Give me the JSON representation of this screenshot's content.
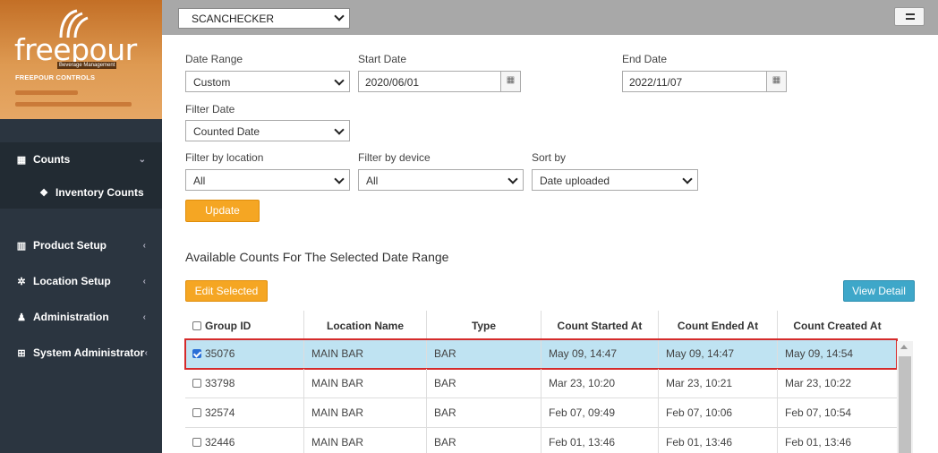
{
  "brand": {
    "name": "freepour",
    "tagline": "Beverage Management",
    "sub": "FREEPOUR CONTROLS"
  },
  "sidebar": {
    "items": [
      {
        "label": "Counts",
        "icon": "table-icon"
      },
      {
        "label": "Inventory Counts",
        "icon": "cubes-icon"
      },
      {
        "label": "Product Setup",
        "icon": "bar-chart-icon"
      },
      {
        "label": "Location Setup",
        "icon": "gear-icon"
      },
      {
        "label": "Administration",
        "icon": "user-icon"
      },
      {
        "label": "System Administrator",
        "icon": "windows-icon"
      }
    ]
  },
  "topbar": {
    "venue": "SCANCHECKER"
  },
  "filters": {
    "date_range_label": "Date Range",
    "date_range_value": "Custom",
    "start_date_label": "Start Date",
    "start_date_value": "2020/06/01",
    "end_date_label": "End Date",
    "end_date_value": "2022/11/07",
    "filter_date_label": "Filter Date",
    "filter_date_value": "Counted Date",
    "location_label": "Filter by location",
    "location_value": "All",
    "device_label": "Filter by device",
    "device_value": "All",
    "sort_label": "Sort by",
    "sort_value": "Date uploaded",
    "update_label": "Update"
  },
  "section_title": "Available Counts For The Selected Date Range",
  "actions": {
    "edit_label": "Edit Selected",
    "view_label": "View Detail"
  },
  "table": {
    "headers": [
      "Group ID",
      "Location Name",
      "Type",
      "Count Started At",
      "Count Ended At",
      "Count Created At"
    ],
    "rows": [
      {
        "id": "35076",
        "location": "MAIN BAR",
        "type": "BAR",
        "started": "May 09, 14:47",
        "ended": "May 09, 14:47",
        "created": "May 09, 14:54",
        "checked": true
      },
      {
        "id": "33798",
        "location": "MAIN BAR",
        "type": "BAR",
        "started": "Mar 23, 10:20",
        "ended": "Mar 23, 10:21",
        "created": "Mar 23, 10:22",
        "checked": false
      },
      {
        "id": "32574",
        "location": "MAIN BAR",
        "type": "BAR",
        "started": "Feb 07, 09:49",
        "ended": "Feb 07, 10:06",
        "created": "Feb 07, 10:54",
        "checked": false
      },
      {
        "id": "32446",
        "location": "MAIN BAR",
        "type": "BAR",
        "started": "Feb 01, 13:46",
        "ended": "Feb 01, 13:46",
        "created": "Feb 01, 13:46",
        "checked": false
      }
    ]
  },
  "colors": {
    "sidebar": "#2b3540",
    "accent_orange": "#f5a623",
    "accent_blue": "#3ea7c9",
    "selected_row": "#bfe3f2",
    "highlight": "#d52b2b"
  }
}
